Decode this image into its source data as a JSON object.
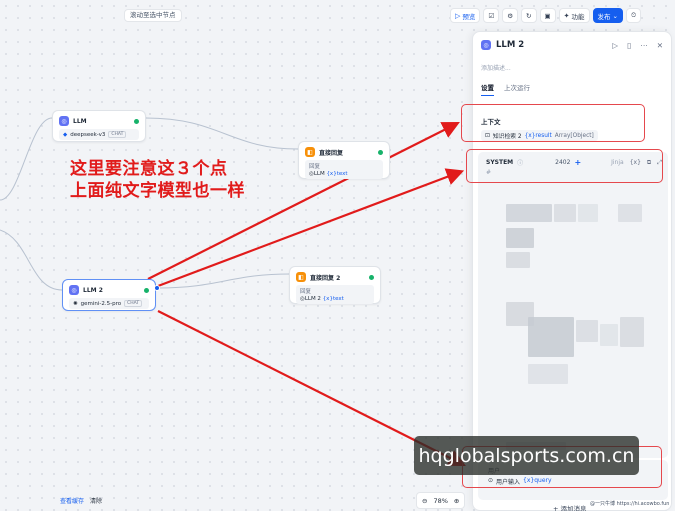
{
  "canvas": {
    "hint": "滚动至选中节点"
  },
  "toolbar": {
    "preview": "预览",
    "features": "功能",
    "publish": "发布"
  },
  "nodes": {
    "llm1": {
      "title": "LLM",
      "model": "deepseek-v3",
      "tag": "CHAT"
    },
    "answer1": {
      "title": "直接回复",
      "label": "回复",
      "ref_node": "LLM",
      "ref_var": "{x}text"
    },
    "llm2": {
      "title": "LLM 2",
      "model": "gemini-2.5-pro",
      "tag": "CHAT"
    },
    "answer2": {
      "title": "直接回复 2",
      "label": "回复",
      "ref_node": "LLM 2",
      "ref_var": "{x}text"
    }
  },
  "annotation": {
    "line1": "这里要注意这３个点",
    "line2": "上面纯文字模型也一样",
    "color": "#e11b1b"
  },
  "panel": {
    "title": "LLM 2",
    "description_placeholder": "添加描述...",
    "tabs": [
      "设置",
      "上次运行"
    ],
    "context": {
      "label": "上下文",
      "source": "知识检索 2",
      "var": "{x}result",
      "type": "Array[Object]"
    },
    "system": {
      "label": "SYSTEM",
      "count": "2402",
      "jinja": "Jinja",
      "var_icon": "{x}"
    },
    "user": {
      "label": "用户",
      "source": "用户输入",
      "var": "{x}query"
    },
    "add_message": "+ 添加消息"
  },
  "bottom": {
    "view_cache": "查看缓存",
    "clear": "清除",
    "zoom": "78%"
  },
  "watermark": "hqglobalsports.com.cn",
  "credit": "@一只牛博 https://hi.acowbo.fun",
  "colors": {
    "accent": "#155eef",
    "highlight": "#e5484d"
  }
}
